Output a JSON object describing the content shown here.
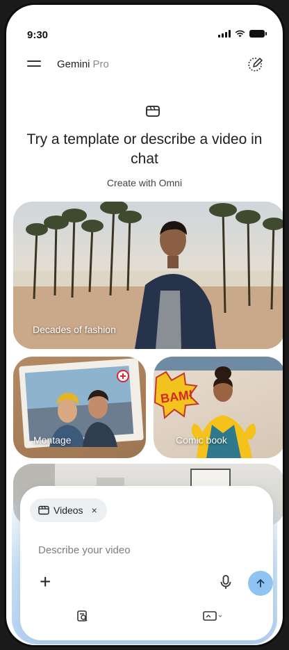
{
  "status_bar": {
    "time": "9:30"
  },
  "header": {
    "app_name": "Gemini",
    "tier": "Pro"
  },
  "hero": {
    "icon": "video-template-icon",
    "title": "Try a template or describe a video in chat",
    "subtitle": "Create with Omni"
  },
  "templates": [
    {
      "label": "Decades of fashion"
    },
    {
      "label": "Montage"
    },
    {
      "label": "Comic book"
    }
  ],
  "composer": {
    "chip_label": "Videos",
    "chip_close": "×",
    "placeholder": "Describe your video",
    "plus": "+"
  },
  "colors": {
    "accent": "#8ec3f2",
    "composer_glow": "#c6def5"
  }
}
